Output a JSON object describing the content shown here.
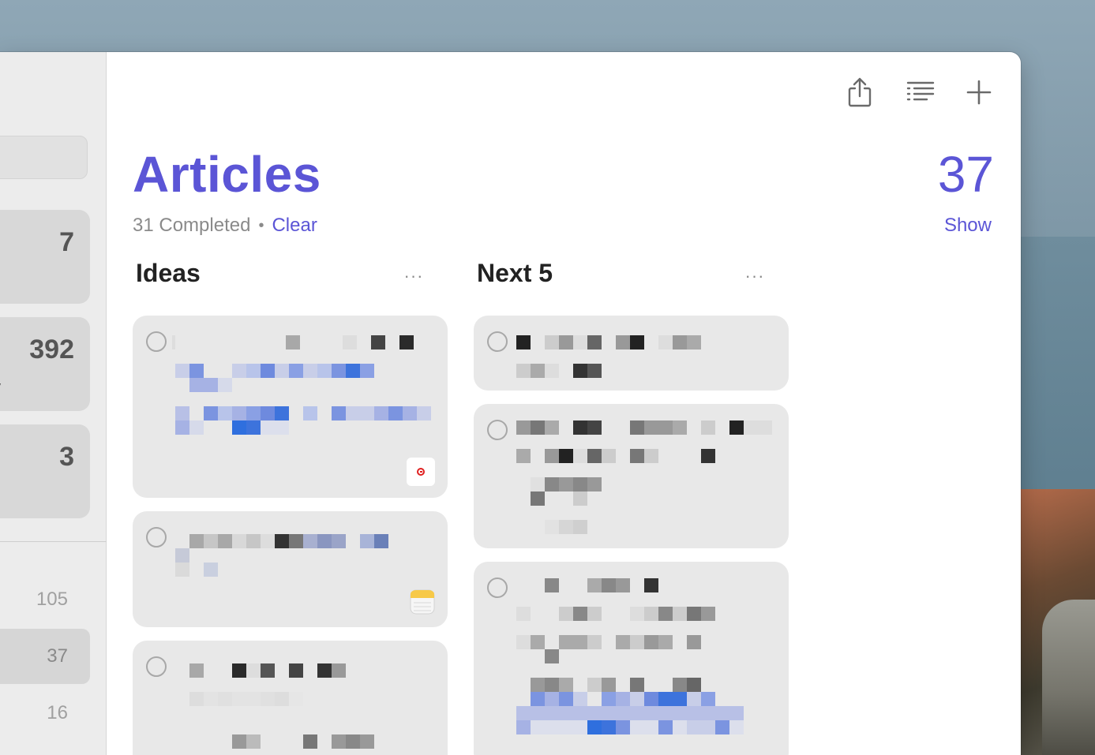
{
  "sidebar": {
    "cards": [
      {
        "count": "7",
        "sub": ""
      },
      {
        "count": "392",
        "sub": "ay"
      },
      {
        "count": "3",
        "sub": ""
      }
    ],
    "list_counts": [
      "105",
      "37",
      "16"
    ]
  },
  "header": {
    "title": "Articles",
    "count": "37",
    "completed_text": "31 Completed",
    "separator": "•",
    "clear_label": "Clear",
    "show_label": "Show"
  },
  "toolbar": {
    "icons": [
      "share-icon",
      "list-view-icon",
      "add-icon"
    ]
  },
  "columns": [
    {
      "title": "Ideas",
      "more_label": "···"
    },
    {
      "title": "Next 5",
      "more_label": "···"
    }
  ],
  "colors": {
    "accent": "#5b55d6",
    "card_bg": "#e8e8e8",
    "link_blue": "#5b55d6"
  }
}
